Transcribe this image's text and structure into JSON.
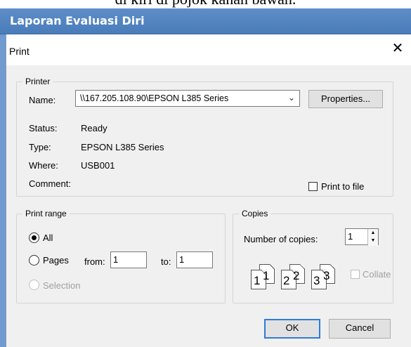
{
  "background_text": "di kiri di pojok kanan bawah.",
  "app": {
    "window_title": "Laporan Evaluasi Diri"
  },
  "dialog": {
    "title": "Print",
    "close_glyph": "✕"
  },
  "printer": {
    "group_label": "Printer",
    "name_label": "Name:",
    "name_value": "\\\\167.205.108.90\\EPSON L385 Series",
    "properties_button": "Properties...",
    "status_label": "Status:",
    "status_value": "Ready",
    "type_label": "Type:",
    "type_value": "EPSON L385 Series",
    "where_label": "Where:",
    "where_value": "USB001",
    "comment_label": "Comment:",
    "print_to_file_label": "Print to file",
    "print_to_file_checked": false
  },
  "print_range": {
    "group_label": "Print range",
    "all_label": "All",
    "pages_label": "Pages",
    "from_label": "from:",
    "from_value": "1",
    "to_label": "to:",
    "to_value": "1",
    "selection_label": "Selection",
    "selected": "All"
  },
  "copies": {
    "group_label": "Copies",
    "number_label": "Number of copies:",
    "number_value": "1",
    "collate_label": "Collate",
    "collate_enabled": false,
    "collate_pages": [
      "1",
      "1",
      "2",
      "2",
      "3",
      "3"
    ]
  },
  "footer": {
    "ok_label": "OK",
    "cancel_label": "Cancel"
  }
}
